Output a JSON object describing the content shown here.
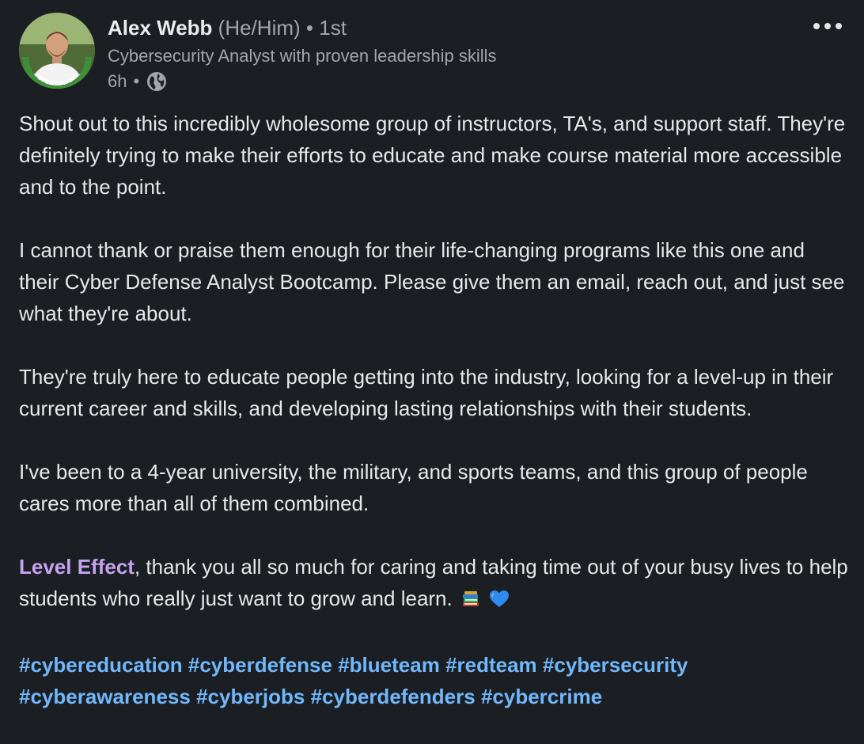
{
  "author": {
    "name": "Alex Webb",
    "pronouns": "(He/Him)",
    "separator": "•",
    "degree": "1st",
    "headline": "Cybersecurity Analyst with proven leadership skills",
    "time": "6h",
    "time_separator": "•",
    "visibility_icon": "globe-icon",
    "avatar_badge": "#OPENTOWORK"
  },
  "menu": {
    "icon": "more-options-icon"
  },
  "post": {
    "paragraphs": [
      "Shout out to this incredibly wholesome group of instructors, TA's, and support staff. They're definitely trying to make their efforts to educate and make course material more accessible and to the point.",
      "I cannot thank or praise them enough for their life-changing programs like this one and their Cyber Defense Analyst Bootcamp. Please give them an email, reach out, and just see what they're about.",
      "They're truly here to educate people getting into the industry, looking for a level-up in their current career and skills, and developing lasting relationships with their students.",
      "I've been to a 4-year university, the military, and sports teams, and this group of people cares more than all of them combined."
    ],
    "mention": "Level Effect",
    "mention_text": ", thank you all so much for caring and taking time out of your busy lives to help students who really just want to grow and learn.",
    "emojis": [
      "books-emoji",
      "blue-heart-emoji"
    ],
    "hashtags": [
      "#cybereducation",
      "#cyberdefense",
      "#blueteam",
      "#redteam",
      "#cybersecurity",
      "#cyberawareness",
      "#cyberjobs",
      "#cyberdefenders",
      "#cybercrime"
    ]
  },
  "colors": {
    "background": "#1b1f23",
    "mention": "#c7a2f3",
    "hashtag": "#71b7fb",
    "open_to_work": "#3f8f3a"
  }
}
